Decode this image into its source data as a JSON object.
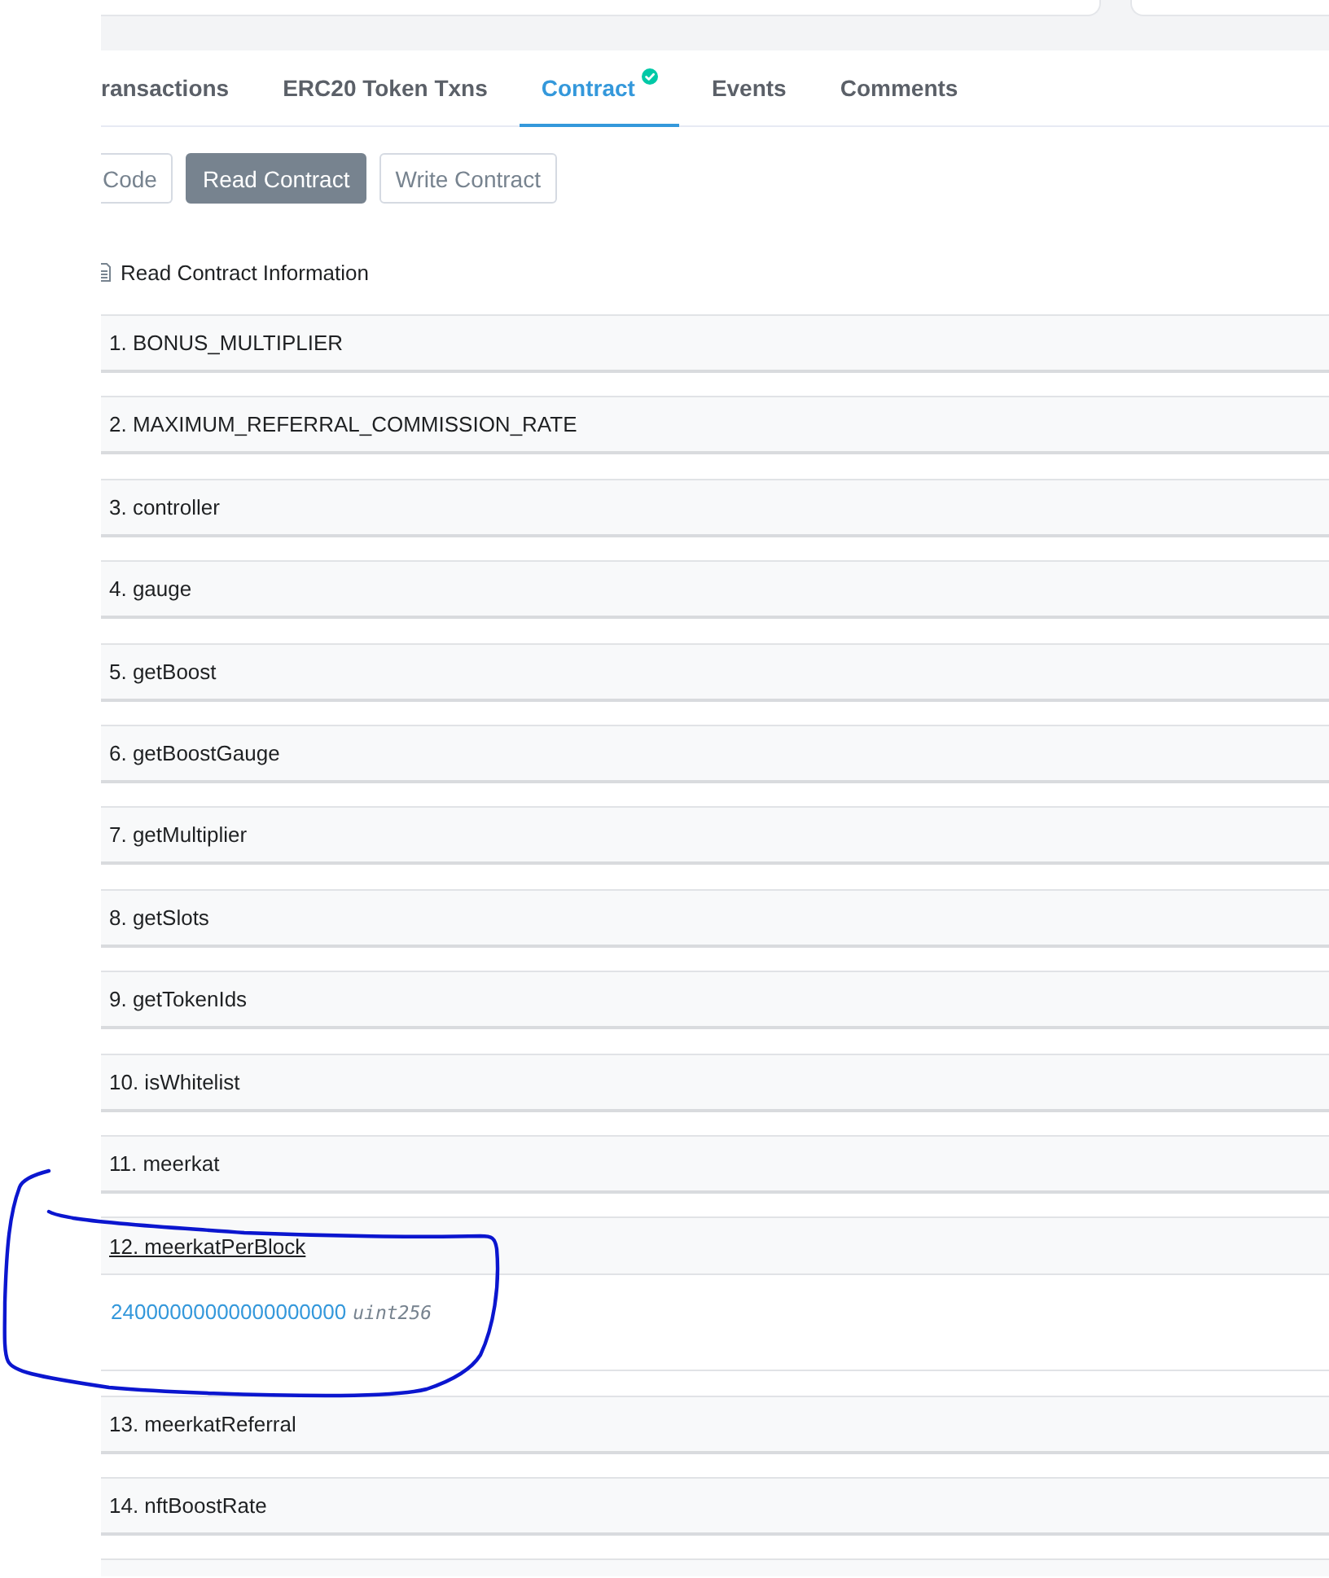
{
  "tabs": [
    {
      "label": "ransactions",
      "selected": false,
      "verified": false
    },
    {
      "label": "ERC20 Token Txns",
      "selected": false,
      "verified": false
    },
    {
      "label": "Contract",
      "selected": true,
      "verified": true
    },
    {
      "label": "Events",
      "selected": false,
      "verified": false
    },
    {
      "label": "Comments",
      "selected": false,
      "verified": false
    }
  ],
  "contract_tabs": [
    {
      "label": "Code",
      "selected": false
    },
    {
      "label": "Read Contract",
      "selected": true
    },
    {
      "label": "Write Contract",
      "selected": false
    }
  ],
  "section_title": "Read Contract Information",
  "functions": [
    {
      "label": "1. BONUS_MULTIPLIER",
      "expanded": false
    },
    {
      "label": "2. MAXIMUM_REFERRAL_COMMISSION_RATE",
      "expanded": false
    },
    {
      "label": "3. controller",
      "expanded": false
    },
    {
      "label": "4. gauge",
      "expanded": false
    },
    {
      "label": "5. getBoost",
      "expanded": false
    },
    {
      "label": "6. getBoostGauge",
      "expanded": false
    },
    {
      "label": "7. getMultiplier",
      "expanded": false
    },
    {
      "label": "8. getSlots",
      "expanded": false
    },
    {
      "label": "9. getTokenIds",
      "expanded": false
    },
    {
      "label": "10. isWhitelist",
      "expanded": false
    },
    {
      "label": "11. meerkat",
      "expanded": false
    },
    {
      "label": "12. meerkatPerBlock",
      "expanded": true,
      "result": {
        "value": "24000000000000000000",
        "type": "uint256"
      }
    },
    {
      "label": "13. meerkatReferral",
      "expanded": false
    },
    {
      "label": "14. nftBoostRate",
      "expanded": false
    }
  ]
}
